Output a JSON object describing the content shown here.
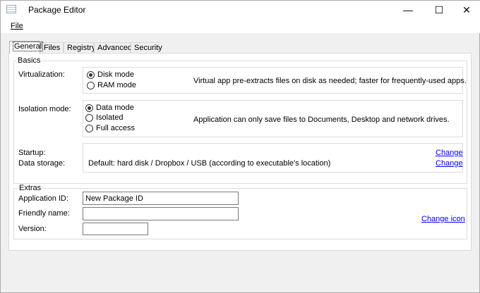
{
  "window": {
    "title": "Package Editor",
    "minimize": "—",
    "maximize": "☐",
    "close": "✕"
  },
  "menu": {
    "file": "File"
  },
  "tabs": [
    "General",
    "Files",
    "Registry",
    "Advanced",
    "Security"
  ],
  "basics": {
    "label": "Basics",
    "virtualization": {
      "label": "Virtualization:",
      "options": [
        "Disk mode",
        "RAM mode"
      ],
      "selected": 0,
      "description": "Virtual app pre-extracts files on disk as needed; faster for frequently-used apps."
    },
    "isolation": {
      "label": "Isolation mode:",
      "options": [
        "Data mode",
        "Isolated",
        "Full access"
      ],
      "selected": 0,
      "description": "Application can only save files to Documents, Desktop and network drives."
    },
    "startup": {
      "label": "Startup:",
      "change": "Change"
    },
    "data_storage": {
      "label": "Data storage:",
      "value": "Default: hard disk / Dropbox / USB (according to executable's location)",
      "change": "Change"
    }
  },
  "extras": {
    "label": "Extras",
    "app_id": {
      "label": "Application ID:",
      "value": "New Package ID"
    },
    "friendly_name": {
      "label": "Friendly name:",
      "value": ""
    },
    "version": {
      "label": "Version:",
      "value": ""
    },
    "change_icon": "Change icon"
  }
}
